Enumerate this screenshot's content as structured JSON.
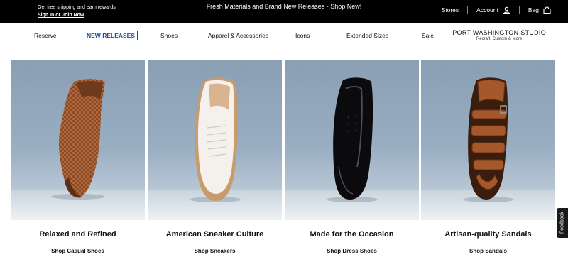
{
  "promo": {
    "left_line1": "Get free shipping and earn rewards.",
    "left_line2": "Sign In or Join Now",
    "center": "Fresh Materials and Brand New Releases - Shop New!",
    "stores": "Stores",
    "account": "Account",
    "bag": "Bag"
  },
  "nav": {
    "items": [
      "Reserve",
      "NEW RELEASES",
      "Shoes",
      "Apparel & Accessories",
      "Icons",
      "Extended Sizes",
      "Sale"
    ],
    "studio_title": "PORT WASHINGTON STUDIO",
    "studio_sub": "Recraft, Custom & More"
  },
  "cards": [
    {
      "title": "Relaxed and Refined",
      "cta": "Shop Casual Shoes"
    },
    {
      "title": "American Sneaker Culture",
      "cta": "Shop Sneakers"
    },
    {
      "title": "Made for the Occasion",
      "cta": "Shop Dress Shoes"
    },
    {
      "title": "Artisan-quality Sandals",
      "cta": "Shop Sandals"
    }
  ],
  "feedback": "Feedback",
  "colors": {
    "accent": "#1f4e9c",
    "promo_bg": "#000000"
  }
}
